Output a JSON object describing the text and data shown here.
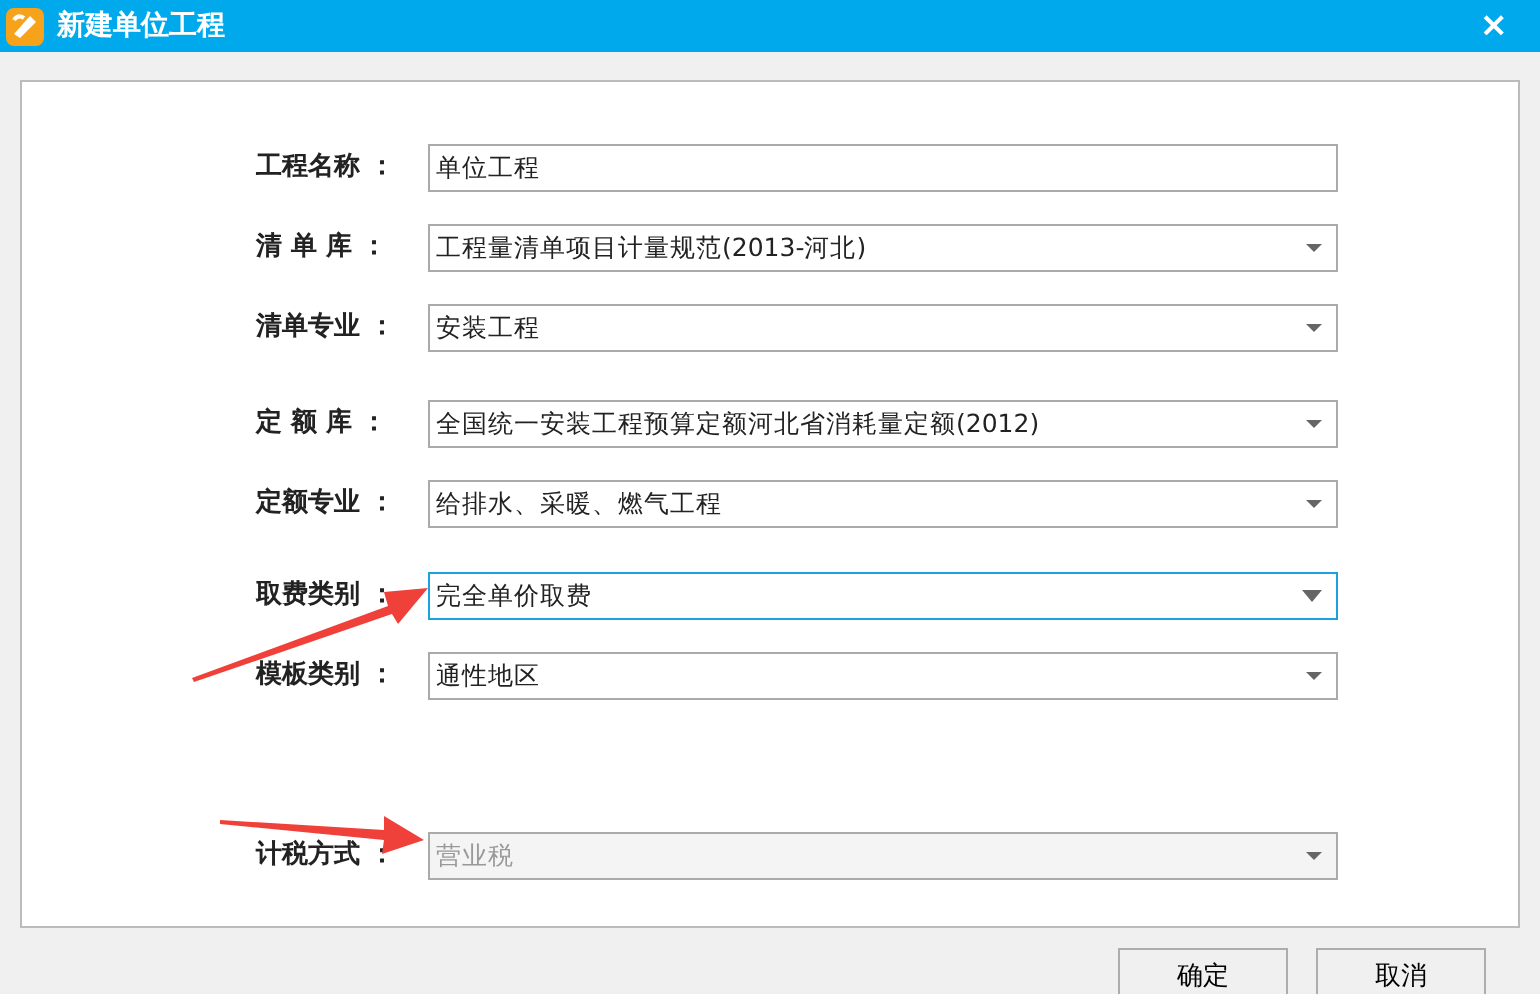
{
  "window": {
    "title": "新建单位工程",
    "close": "×"
  },
  "fields": [
    {
      "label": "工程名称 ：",
      "kind": "text",
      "value": "单位工程",
      "focused": false,
      "disabled": false
    },
    {
      "label": "清 单 库 ：",
      "kind": "select",
      "value": "工程量清单项目计量规范(2013-河北)",
      "focused": false,
      "disabled": false
    },
    {
      "label": "清单专业 ：",
      "kind": "select",
      "value": "安装工程",
      "focused": false,
      "disabled": false
    },
    {
      "label": "定 额 库 ：",
      "kind": "select",
      "value": "全国统一安装工程预算定额河北省消耗量定额(2012)",
      "focused": false,
      "disabled": false
    },
    {
      "label": "定额专业 ：",
      "kind": "select",
      "value": "给排水、采暖、燃气工程",
      "focused": false,
      "disabled": false
    },
    {
      "label": "取费类别 ：",
      "kind": "select",
      "value": "完全单价取费",
      "focused": true,
      "disabled": false
    },
    {
      "label": "模板类别 ：",
      "kind": "select",
      "value": "通性地区",
      "focused": false,
      "disabled": false
    },
    {
      "label": "计税方式 ：",
      "kind": "select",
      "value": "营业税",
      "focused": false,
      "disabled": true
    }
  ],
  "buttons": [
    "确定",
    "取消"
  ]
}
